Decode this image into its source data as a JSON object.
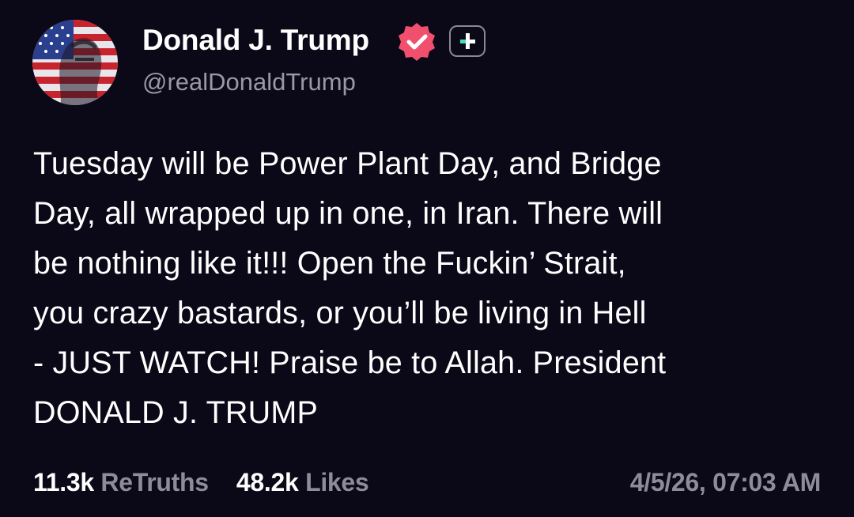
{
  "author": {
    "display_name": "Donald J. Trump",
    "handle": "@realDonaldTrump",
    "avatar_icon": "flag-portrait-avatar",
    "verified_icon": "verified-check-badge-icon",
    "plus_icon": "truth-plus-badge-icon"
  },
  "post": {
    "text_lines": [
      "Tuesday will be Power Plant Day, and Bridge",
      "Day, all wrapped up in one, in Iran. There will",
      "be nothing like it!!! Open the Fuckin’ Strait,",
      "you crazy bastards, or you’ll be living in Hell",
      "- JUST WATCH! Praise be to Allah. President",
      "DONALD J. TRUMP"
    ]
  },
  "stats": {
    "retruths_count": "11.3k",
    "retruths_label": "ReTruths",
    "likes_count": "48.2k",
    "likes_label": "Likes"
  },
  "timestamp": "4/5/26, 07:03 AM",
  "colors": {
    "background": "#0b0817",
    "text": "#ffffff",
    "muted": "#8e8c9a",
    "verified": "#f0506e",
    "plus_accent": "#3fe0c5"
  }
}
